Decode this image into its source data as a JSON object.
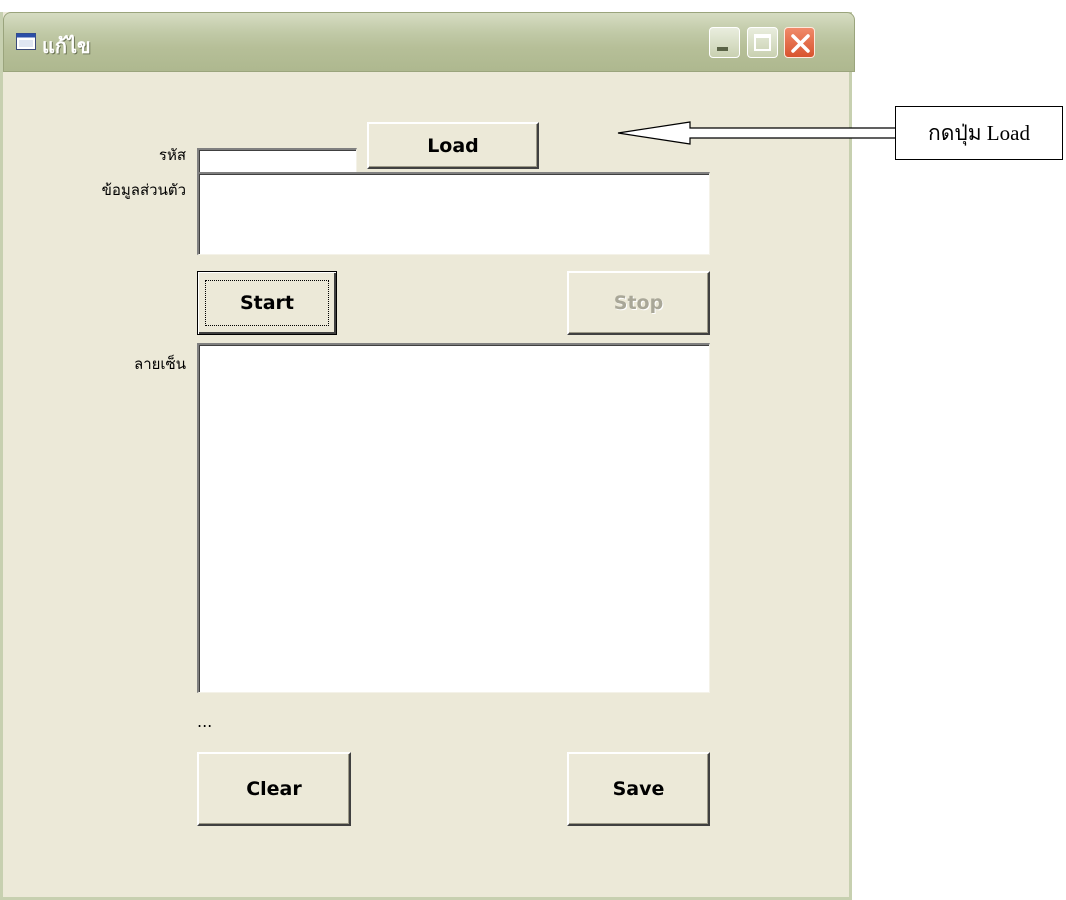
{
  "window": {
    "title": "แก้ไข"
  },
  "title_buttons": {
    "minimize": "minimize-icon",
    "maximize": "maximize-icon",
    "close": "close-icon"
  },
  "form": {
    "code_label": "รหัส",
    "code_value": "",
    "info_label": "ข้อมูลส่วนตัว",
    "info_value": "",
    "signature_label": "ลายเซ็น",
    "status_text": "...",
    "buttons": {
      "load": "Load",
      "start": "Start",
      "stop": "Stop",
      "clear": "Clear",
      "save": "Save"
    }
  },
  "annotation": {
    "text": "กดปุ่ม Load"
  },
  "colors": {
    "window_bg": "#ece9d8",
    "titlebar": "#b6bf98",
    "close_button": "#d8542e"
  }
}
